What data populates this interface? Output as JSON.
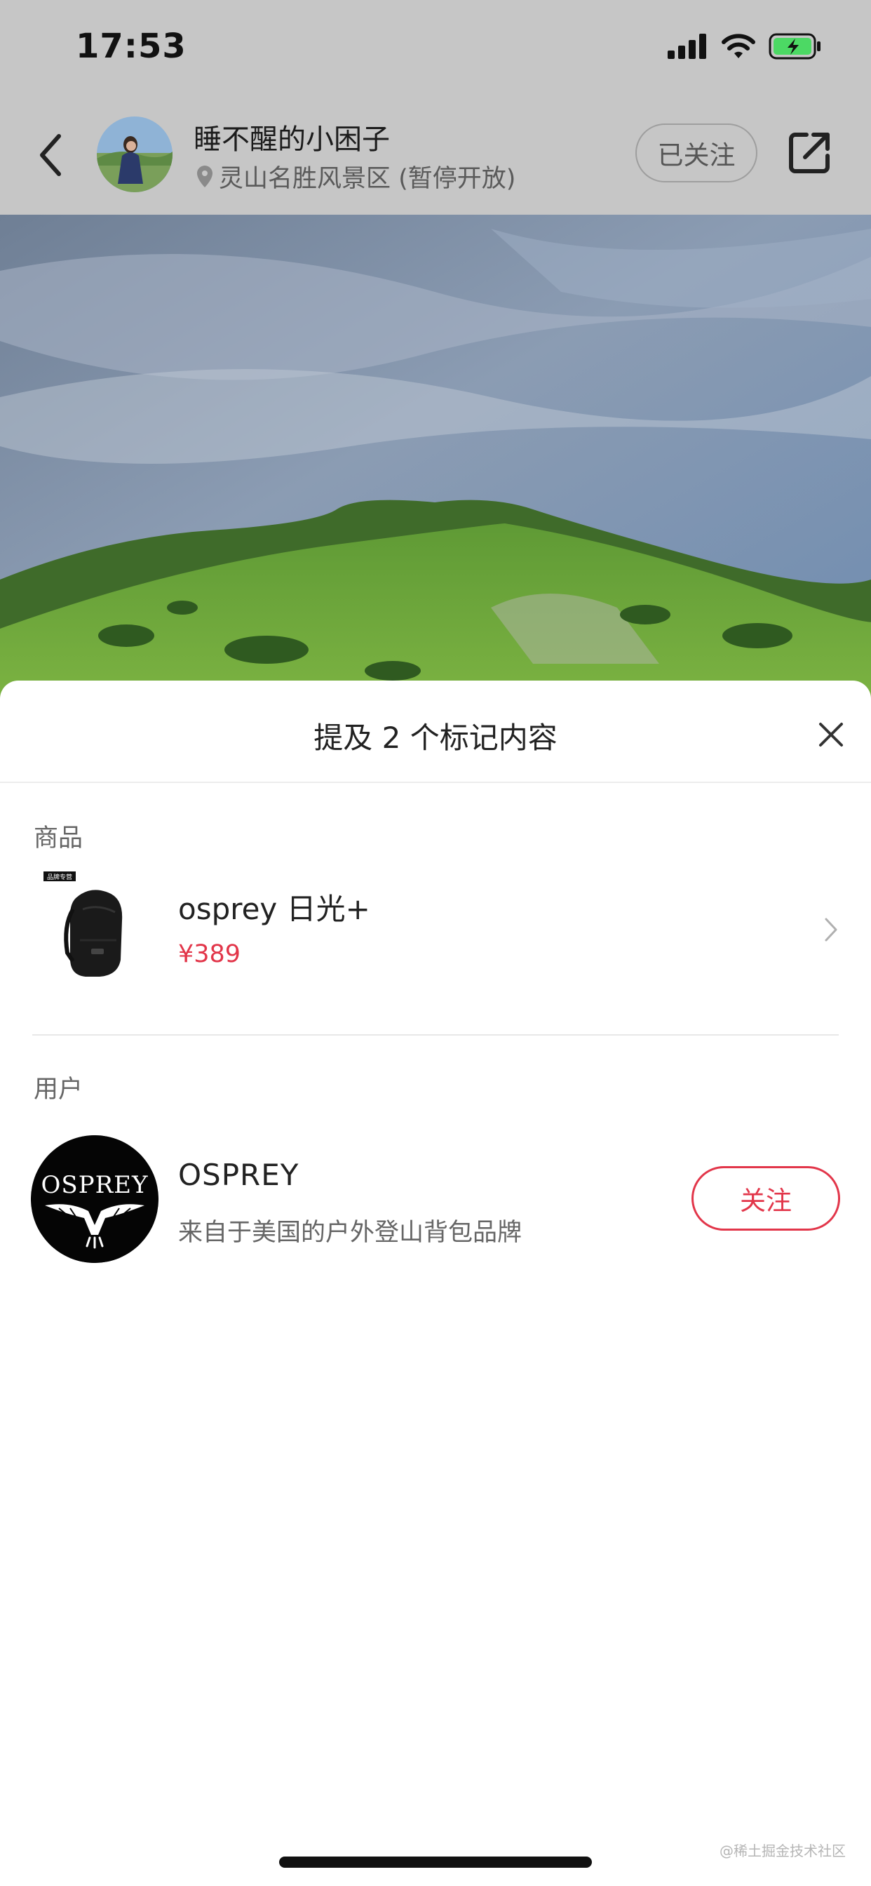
{
  "status_bar": {
    "time": "17:53"
  },
  "post_header": {
    "author_name": "睡不醒的小困子",
    "location": "灵山名胜风景区 (暂停开放)",
    "followed_label": "已关注"
  },
  "sheet": {
    "title": "提及 2 个标记内容",
    "product_section_label": "商品",
    "product": {
      "badge": "品牌专营",
      "name": "osprey 日光+",
      "price": "¥389"
    },
    "user_section_label": "用户",
    "user": {
      "logo_text": "OSPREY",
      "name": "OSPREY",
      "description": "来自于美国的户外登山背包品牌",
      "follow_label": "关注"
    }
  },
  "watermark": "@稀土掘金技术社区",
  "colors": {
    "accent_red": "#e2364a",
    "header_gray": "#c6c6c6",
    "battery_green": "#4cd964"
  }
}
